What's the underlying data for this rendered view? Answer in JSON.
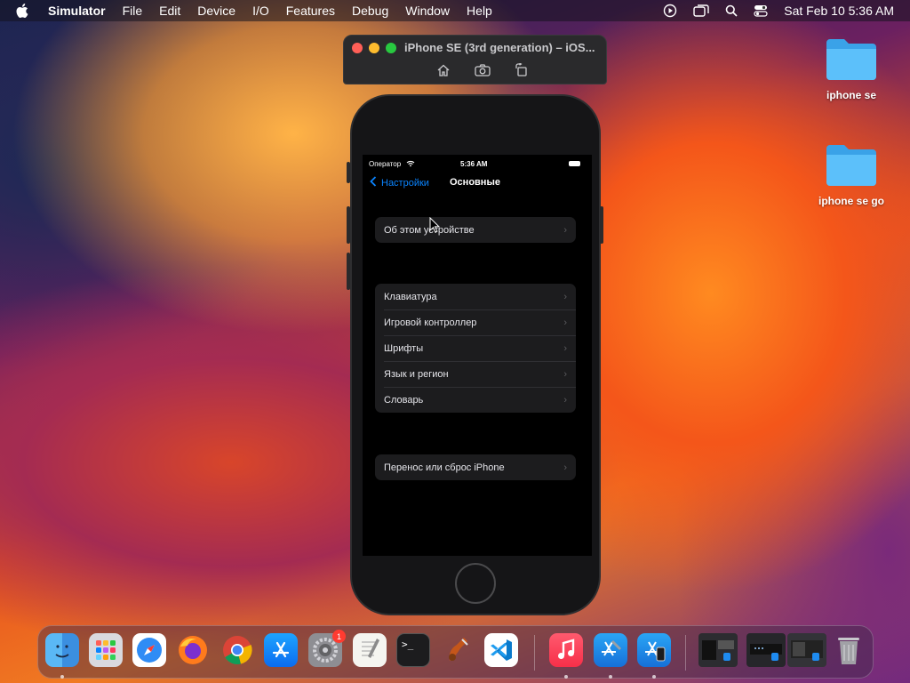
{
  "menubar": {
    "app_name": "Simulator",
    "items": [
      "File",
      "Edit",
      "Device",
      "I/O",
      "Features",
      "Debug",
      "Window",
      "Help"
    ],
    "clock": "Sat Feb 10  5:36 AM"
  },
  "desktop": {
    "folders": [
      {
        "label": "iphone se"
      },
      {
        "label": "iphone se go"
      }
    ]
  },
  "simulator": {
    "window_title": "iPhone SE (3rd generation) – iOS...",
    "toolbar": [
      "home-icon",
      "screenshot-icon",
      "rotate-icon"
    ],
    "status_bar": {
      "carrier": "Оператор",
      "time": "5:36 AM"
    },
    "nav": {
      "back_label": "Настройки",
      "title": "Основные"
    },
    "groups": [
      [
        "Об этом устройстве"
      ],
      [
        "Клавиатура",
        "Игровой контроллер",
        "Шрифты",
        "Язык и регион",
        "Словарь"
      ],
      [
        "Перенос или сброс iPhone"
      ]
    ],
    "chevron": "›"
  },
  "dock": {
    "apps": [
      "Finder",
      "Launchpad",
      "Safari",
      "Firefox",
      "Chrome",
      "App Store",
      "System Settings",
      "TextEdit",
      "Terminal",
      "Instruments",
      "Visual Studio Code",
      "Music",
      "Xcode",
      "Simulator"
    ],
    "settings_badge": "1",
    "terminal_prompt": ">_"
  },
  "colors": {
    "accent": "#0a84ff",
    "screen_bg": "#000000",
    "cell_bg": "#1c1c1e"
  }
}
